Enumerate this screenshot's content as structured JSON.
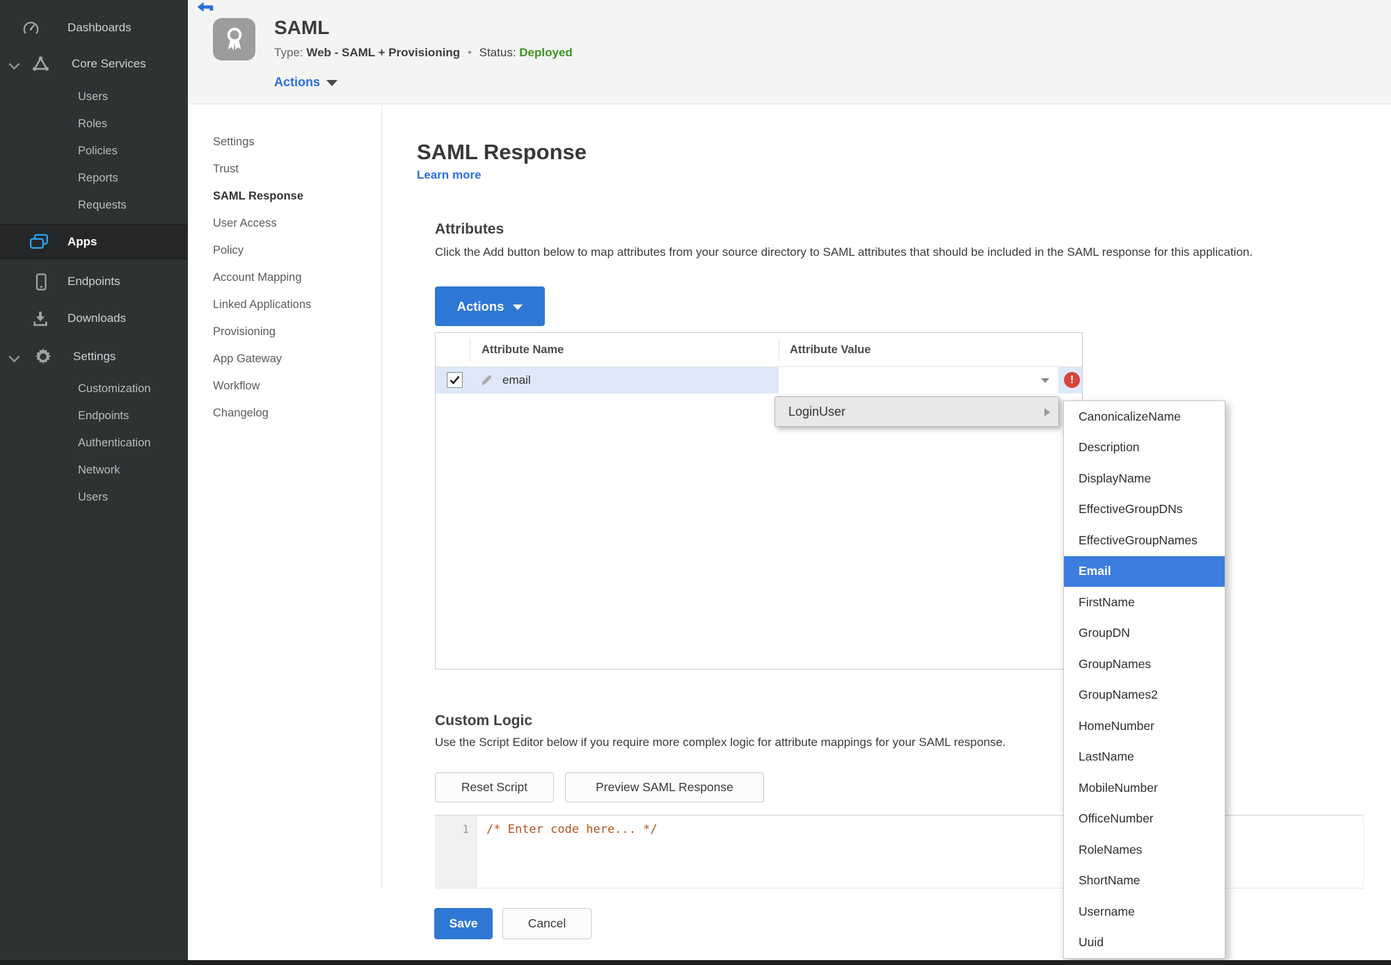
{
  "colors": {
    "accent_blue": "#2e77d4",
    "link_blue": "#2b6fdb",
    "status_green": "#3e9420",
    "error_red": "#d9453c",
    "selection_blue": "#3b7ddd",
    "row_highlight": "#dde9f8",
    "apps_icon_blue": "#2ba3ea",
    "code_comment": "#b0571c"
  },
  "sidebar": {
    "dashboards": "Dashboards",
    "core_services": "Core Services",
    "core_items": [
      "Users",
      "Roles",
      "Policies",
      "Reports",
      "Requests"
    ],
    "apps": "Apps",
    "endpoints": "Endpoints",
    "downloads": "Downloads",
    "settings": "Settings",
    "settings_items": [
      "Customization",
      "Endpoints",
      "Authentication",
      "Network",
      "Users"
    ]
  },
  "header": {
    "app_name": "SAML",
    "type_label": "Type:",
    "type_value": "Web - SAML + Provisioning",
    "separator": "•",
    "status_label": "Status:",
    "status_value": "Deployed",
    "actions_label": "Actions"
  },
  "side_nav": {
    "items": [
      "Settings",
      "Trust",
      "SAML Response",
      "User Access",
      "Policy",
      "Account Mapping",
      "Linked Applications",
      "Provisioning",
      "App Gateway",
      "Workflow",
      "Changelog"
    ],
    "active": "SAML Response"
  },
  "main": {
    "title": "SAML Response",
    "learn_more": "Learn more",
    "attributes": {
      "heading": "Attributes",
      "description": "Click the Add button below to map attributes from your source directory to SAML attributes that should be included in the SAML response for this application.",
      "actions_button": "Actions",
      "table": {
        "columns": [
          "Attribute Name",
          "Attribute Value"
        ],
        "rows": [
          {
            "name": "email",
            "value": "",
            "checked": true,
            "error": true
          }
        ]
      }
    },
    "value_menu": {
      "label": "LoginUser"
    },
    "attribute_submenu": {
      "items": [
        "CanonicalizeName",
        "Description",
        "DisplayName",
        "EffectiveGroupDNs",
        "EffectiveGroupNames",
        "Email",
        "FirstName",
        "GroupDN",
        "GroupNames",
        "GroupNames2",
        "HomeNumber",
        "LastName",
        "MobileNumber",
        "OfficeNumber",
        "RoleNames",
        "ShortName",
        "Username",
        "Uuid"
      ],
      "selected": "Email"
    },
    "custom_logic": {
      "heading": "Custom Logic",
      "description": "Use the Script Editor below if you require more complex logic for attribute mappings for your SAML response.",
      "reset_button": "Reset Script",
      "preview_button": "Preview SAML Response",
      "editor": {
        "line_number": "1",
        "code": "/* Enter code here... */"
      }
    },
    "save_button": "Save",
    "cancel_button": "Cancel"
  }
}
